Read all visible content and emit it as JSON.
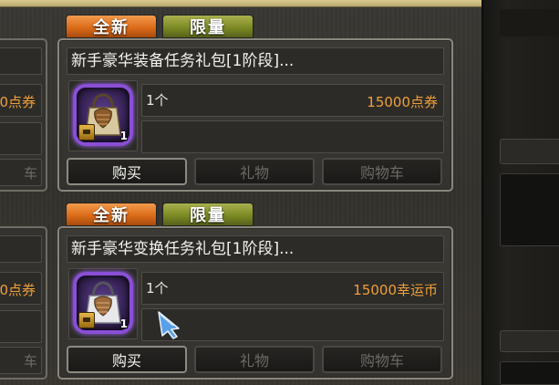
{
  "left_partial": [
    {
      "price_fragment": "0点券",
      "button_fragment": "车"
    },
    {
      "price_fragment": "0点券",
      "button_fragment": "车"
    }
  ],
  "items": [
    {
      "tag_new": "全新",
      "tag_limited": "限量",
      "title": "新手豪华装备任务礼包[1阶段]...",
      "quantity": "1个",
      "price": "15000点券",
      "icon_stack": "1",
      "icon": "gift-bag-icon",
      "buttons": {
        "buy": "购买",
        "gift": "礼物",
        "cart": "购物车"
      }
    },
    {
      "tag_new": "全新",
      "tag_limited": "限量",
      "title": "新手豪华变换任务礼包[1阶段]...",
      "quantity": "1个",
      "price": "15000幸运币",
      "icon_stack": "1",
      "icon": "gift-bag-icon",
      "buttons": {
        "buy": "购买",
        "gift": "礼物",
        "cart": "购物车"
      }
    }
  ],
  "colors": {
    "price": "#f0a03a",
    "tag_new": "#dc6c1a",
    "tag_limited": "#7d8a24",
    "icon_frame": "#8a4fd6"
  }
}
